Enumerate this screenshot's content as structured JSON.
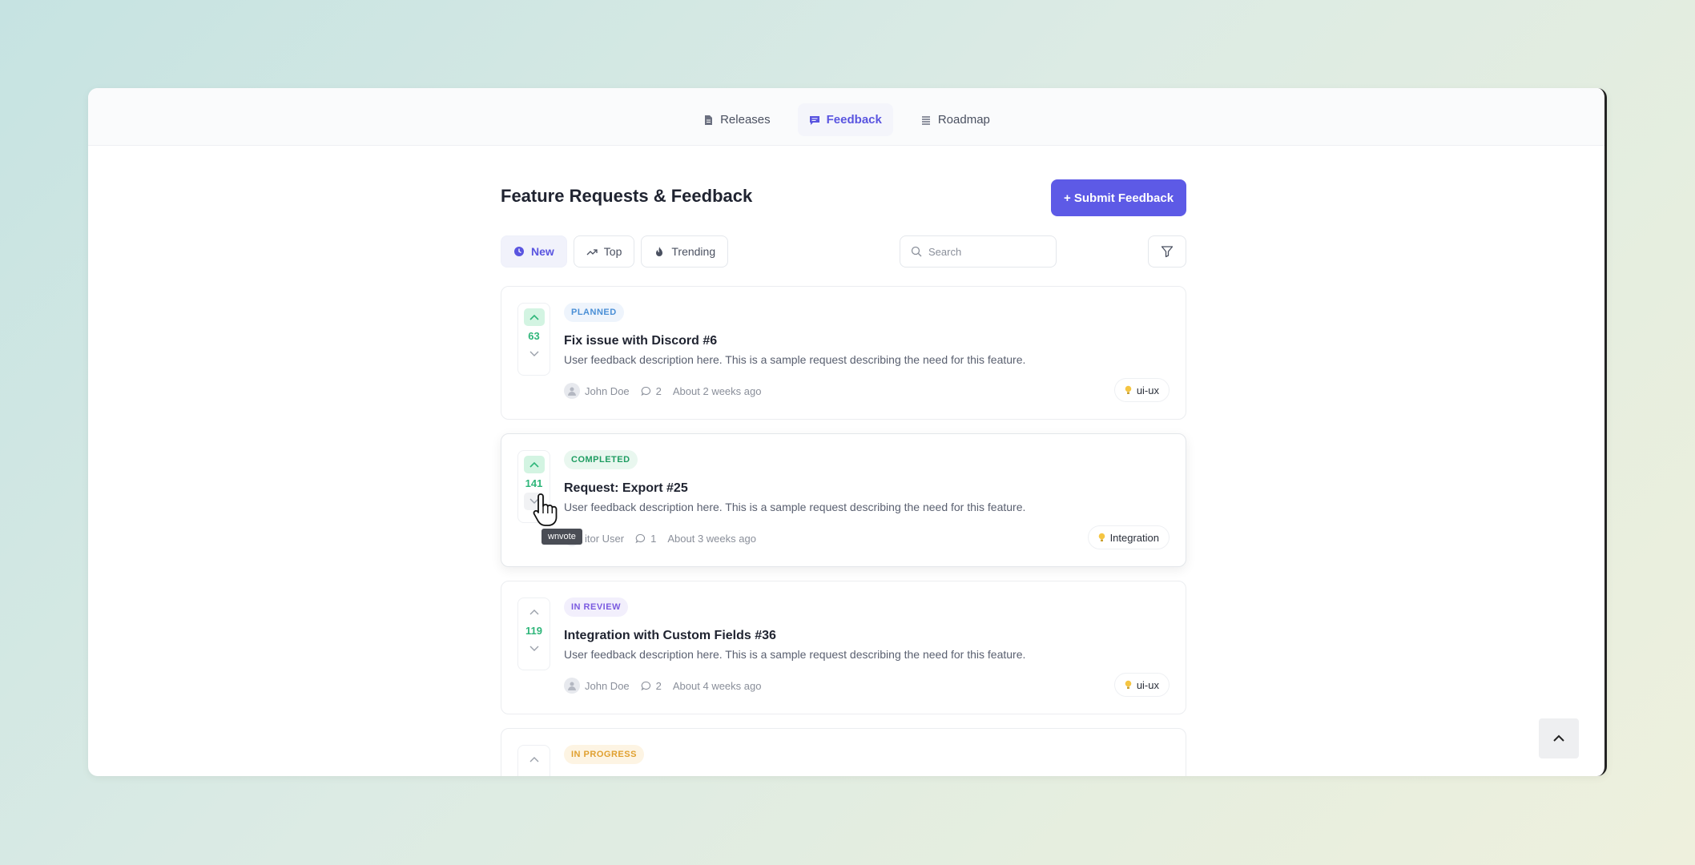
{
  "nav": {
    "tabs": [
      {
        "label": "Releases",
        "icon": "document-icon"
      },
      {
        "label": "Feedback",
        "icon": "message-icon",
        "active": true
      },
      {
        "label": "Roadmap",
        "icon": "list-icon"
      }
    ]
  },
  "page": {
    "title": "Feature Requests & Feedback",
    "submit_label": "+ Submit Feedback"
  },
  "filters": [
    {
      "label": "New",
      "icon": "clock-icon",
      "active": true
    },
    {
      "label": "Top",
      "icon": "trending-up-icon"
    },
    {
      "label": "Trending",
      "icon": "flame-icon"
    }
  ],
  "search": {
    "placeholder": "Search"
  },
  "colors": {
    "accent": "#5d5ae6",
    "vote_green": "#2fb67a",
    "planned": "#4a8fd6",
    "completed": "#1f9d62",
    "in_review": "#7a5ae0",
    "in_progress": "#e0a030"
  },
  "items": [
    {
      "status": "PLANNED",
      "votes": "63",
      "title": "Fix issue with Discord #6",
      "description": "User feedback description here. This is a sample request describing the need for this feature.",
      "author": "John Doe",
      "comments": "2",
      "time": "About 2 weeks ago",
      "tag": "ui-ux",
      "upvoted": true
    },
    {
      "status": "COMPLETED",
      "votes": "141",
      "title": "Request: Export #25",
      "description": "User feedback description here. This is a sample request describing the need for this feature.",
      "author": "itor User",
      "comments": "1",
      "time": "About 3 weeks ago",
      "tag": "Integration",
      "upvoted": true,
      "tooltip": "wnvote"
    },
    {
      "status": "IN REVIEW",
      "votes": "119",
      "title": "Integration with Custom Fields #36",
      "description": "User feedback description here. This is a sample request describing the need for this feature.",
      "author": "John Doe",
      "comments": "2",
      "time": "About 4 weeks ago",
      "tag": "ui-ux",
      "upvoted": false
    },
    {
      "status": "IN PROGRESS"
    }
  ]
}
